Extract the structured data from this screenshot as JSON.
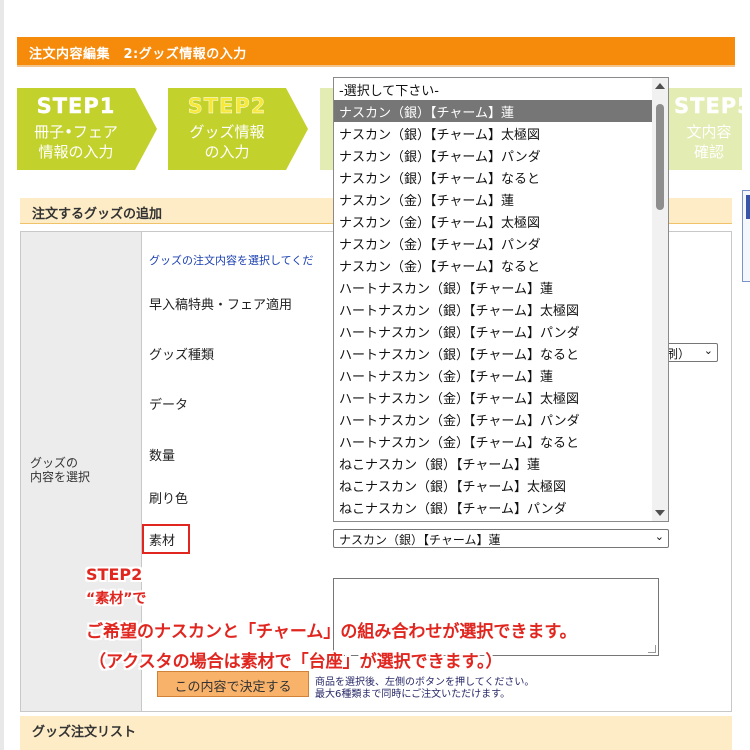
{
  "header": {
    "title": "注文内容編集　2:グッズ情報の入力"
  },
  "steps": [
    {
      "title": "STEP1",
      "label_line1": "冊子•フェア",
      "label_line2": "情報の入力",
      "color": "#c3d12c"
    },
    {
      "title": "STEP2",
      "label_line1": "グッズ情報",
      "label_line2": "の入力",
      "color": "#c3d12c"
    },
    {
      "title": "STEP5",
      "label_line1": "文内容",
      "label_line2": "確認",
      "color": "#e3ecb2"
    }
  ],
  "section": {
    "title": "注文するグッズの追加"
  },
  "form": {
    "label": {
      "line1": "グッズの",
      "line2": "内容を選択"
    },
    "instruction": "グッズの注文内容を選択してくだ",
    "rows": {
      "early_bird": "早入稿特典・フェア適用",
      "goods_type": "グッズ種類",
      "data": "データ",
      "quantity": "数量",
      "print_color": "刷り色",
      "material": "素材"
    },
    "goods_type_value_visible": "刷）",
    "material_select_value": "ナスカン（銀）【チャーム】蓮",
    "decide_button": "この内容で決定する",
    "note_line1": "商品を選択後、左側のボタンを押してください。",
    "note_line2": "最大6種類まで同時にご注文いただけます。"
  },
  "dropdown": {
    "placeholder": "-選択して下さい-",
    "selected_index": 0,
    "options": [
      "ナスカン（銀）【チャーム】蓮",
      "ナスカン（銀）【チャーム】太極図",
      "ナスカン（銀）【チャーム】パンダ",
      "ナスカン（銀）【チャーム】なると",
      "ナスカン（金）【チャーム】蓮",
      "ナスカン（金）【チャーム】太極図",
      "ナスカン（金）【チャーム】パンダ",
      "ナスカン（金）【チャーム】なると",
      "ハートナスカン（銀）【チャーム】蓮",
      "ハートナスカン（銀）【チャーム】太極図",
      "ハートナスカン（銀）【チャーム】パンダ",
      "ハートナスカン（銀）【チャーム】なると",
      "ハートナスカン（金）【チャーム】蓮",
      "ハートナスカン（金）【チャーム】太極図",
      "ハートナスカン（金）【チャーム】パンダ",
      "ハートナスカン（金）【チャーム】なると",
      "ねこナスカン（銀）【チャーム】蓮",
      "ねこナスカン（銀）【チャーム】太極図",
      "ねこナスカン（銀）【チャーム】パンダ"
    ]
  },
  "callout": {
    "line1": "STEP2",
    "line2": "“素材”で",
    "line3": "ご希望のナスカンと「チャーム」の組み合わせが選択できます。",
    "line4": "（アクスタの場合は素材で「台座」が選択できます。）",
    "color": "#e0261f"
  },
  "bottom": {
    "title": "グッズ注文リスト"
  }
}
